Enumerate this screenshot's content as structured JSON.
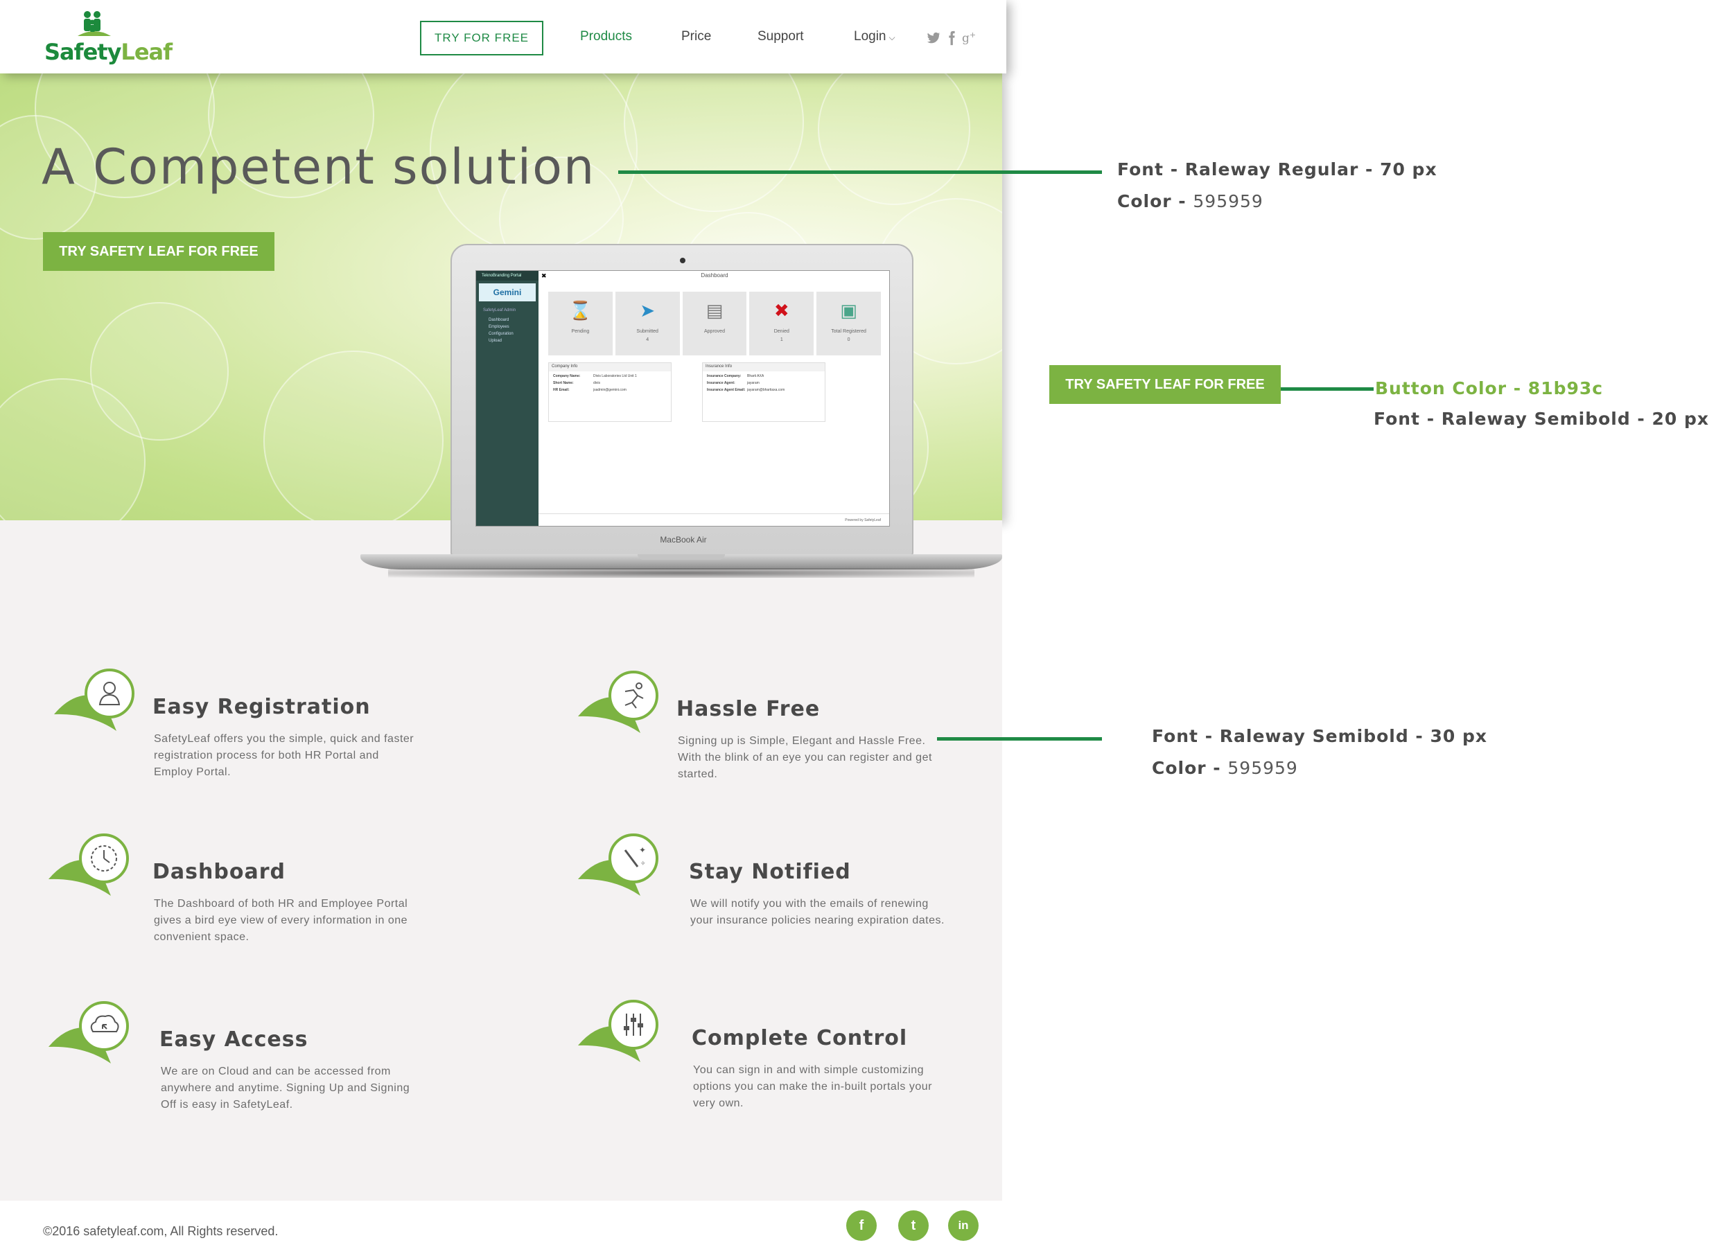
{
  "header": {
    "logo_text_1": "Safety",
    "logo_text_2": "Leaf",
    "try_free": "TRY FOR FREE",
    "nav": [
      "Products",
      "Price",
      "Support",
      "Login"
    ],
    "social_icons": [
      "twitter-icon",
      "facebook-icon",
      "google-plus-icon"
    ]
  },
  "hero": {
    "title": "A Competent solution",
    "cta": "TRY SAFETY LEAF FOR FREE"
  },
  "laptop": {
    "brand": "MacBook Air",
    "screen": {
      "portal": "TeknoBranding Portal",
      "org": "Gemini",
      "admin": "SafetyLeaf Admin",
      "menu": [
        "Dashboard",
        "Employees",
        "Configuration",
        "Upload"
      ],
      "title": "Dashboard",
      "cards": [
        {
          "label": "Pending",
          "count": ""
        },
        {
          "label": "Submitted",
          "count": "4"
        },
        {
          "label": "Approved",
          "count": ""
        },
        {
          "label": "Denied",
          "count": "1"
        },
        {
          "label": "Total Registered",
          "count": "0"
        }
      ],
      "company_info": {
        "title": "Company Info",
        "rows": [
          [
            "Company Name:",
            "Divis Laboratories Ltd Unit 1"
          ],
          [
            "Short Name:",
            "divis"
          ],
          [
            "HR Email:",
            "jsadmin@gemini.com"
          ]
        ]
      },
      "insurance_info": {
        "title": "Insurance Info",
        "rows": [
          [
            "Insurance Company:",
            "Bharti AXA"
          ],
          [
            "Insurance Agent:",
            "jayaram"
          ],
          [
            "Insurance Agent Email:",
            "jayaram@bhartiaxa.com"
          ]
        ]
      },
      "footer": "Powered by SafetyLeaf"
    }
  },
  "features": [
    {
      "title": "Easy Registration",
      "text": "SafetyLeaf offers you the simple, quick and faster registration process for both HR Portal and Employ Portal.",
      "icon": "user-icon"
    },
    {
      "title": "Hassle Free",
      "text": "Signing up is Simple, Elegant and Hassle Free. With the blink of an eye you can register and get started.",
      "icon": "running-man-icon"
    },
    {
      "title": "Dashboard",
      "text": "The Dashboard of both HR and Employee Portal gives a  bird eye view of every information in one convenient space.",
      "icon": "clock-icon"
    },
    {
      "title": "Stay Notified",
      "text": "We will notify you with the emails of renewing your insurance policies nearing expiration dates.",
      "icon": "magic-wand-icon"
    },
    {
      "title": "Easy Access",
      "text": "We are on Cloud and can be accessed from anywhere and anytime. Signing Up and Signing Off is easy in SafetyLeaf.",
      "icon": "cloud-icon"
    },
    {
      "title": "Complete Control",
      "text": "You can sign in and with simple customizing options you can make the in-built portals your very own.",
      "icon": "sliders-icon"
    }
  ],
  "footer": {
    "copyright": "©2016 safetyleaf.com, All Rights reserved.",
    "social": [
      "f",
      "t",
      "in"
    ]
  },
  "annotations": {
    "title_font_label": "Font - Raleway Regular - 70 px",
    "title_color_label": "Color - ",
    "title_color_value": "595959",
    "button_sample": "TRY SAFETY LEAF FOR FREE",
    "button_color": "Button Color - 81b93c",
    "button_font": "Font - Raleway Semibold - 20 px",
    "feature_font": "Font - Raleway Semibold - 30 px",
    "feature_color_label": "Color - ",
    "feature_color_value": "595959"
  },
  "colors": {
    "brand_green": "#7cb342",
    "dark_green": "#1f8a45",
    "text_gray": "#595959"
  }
}
